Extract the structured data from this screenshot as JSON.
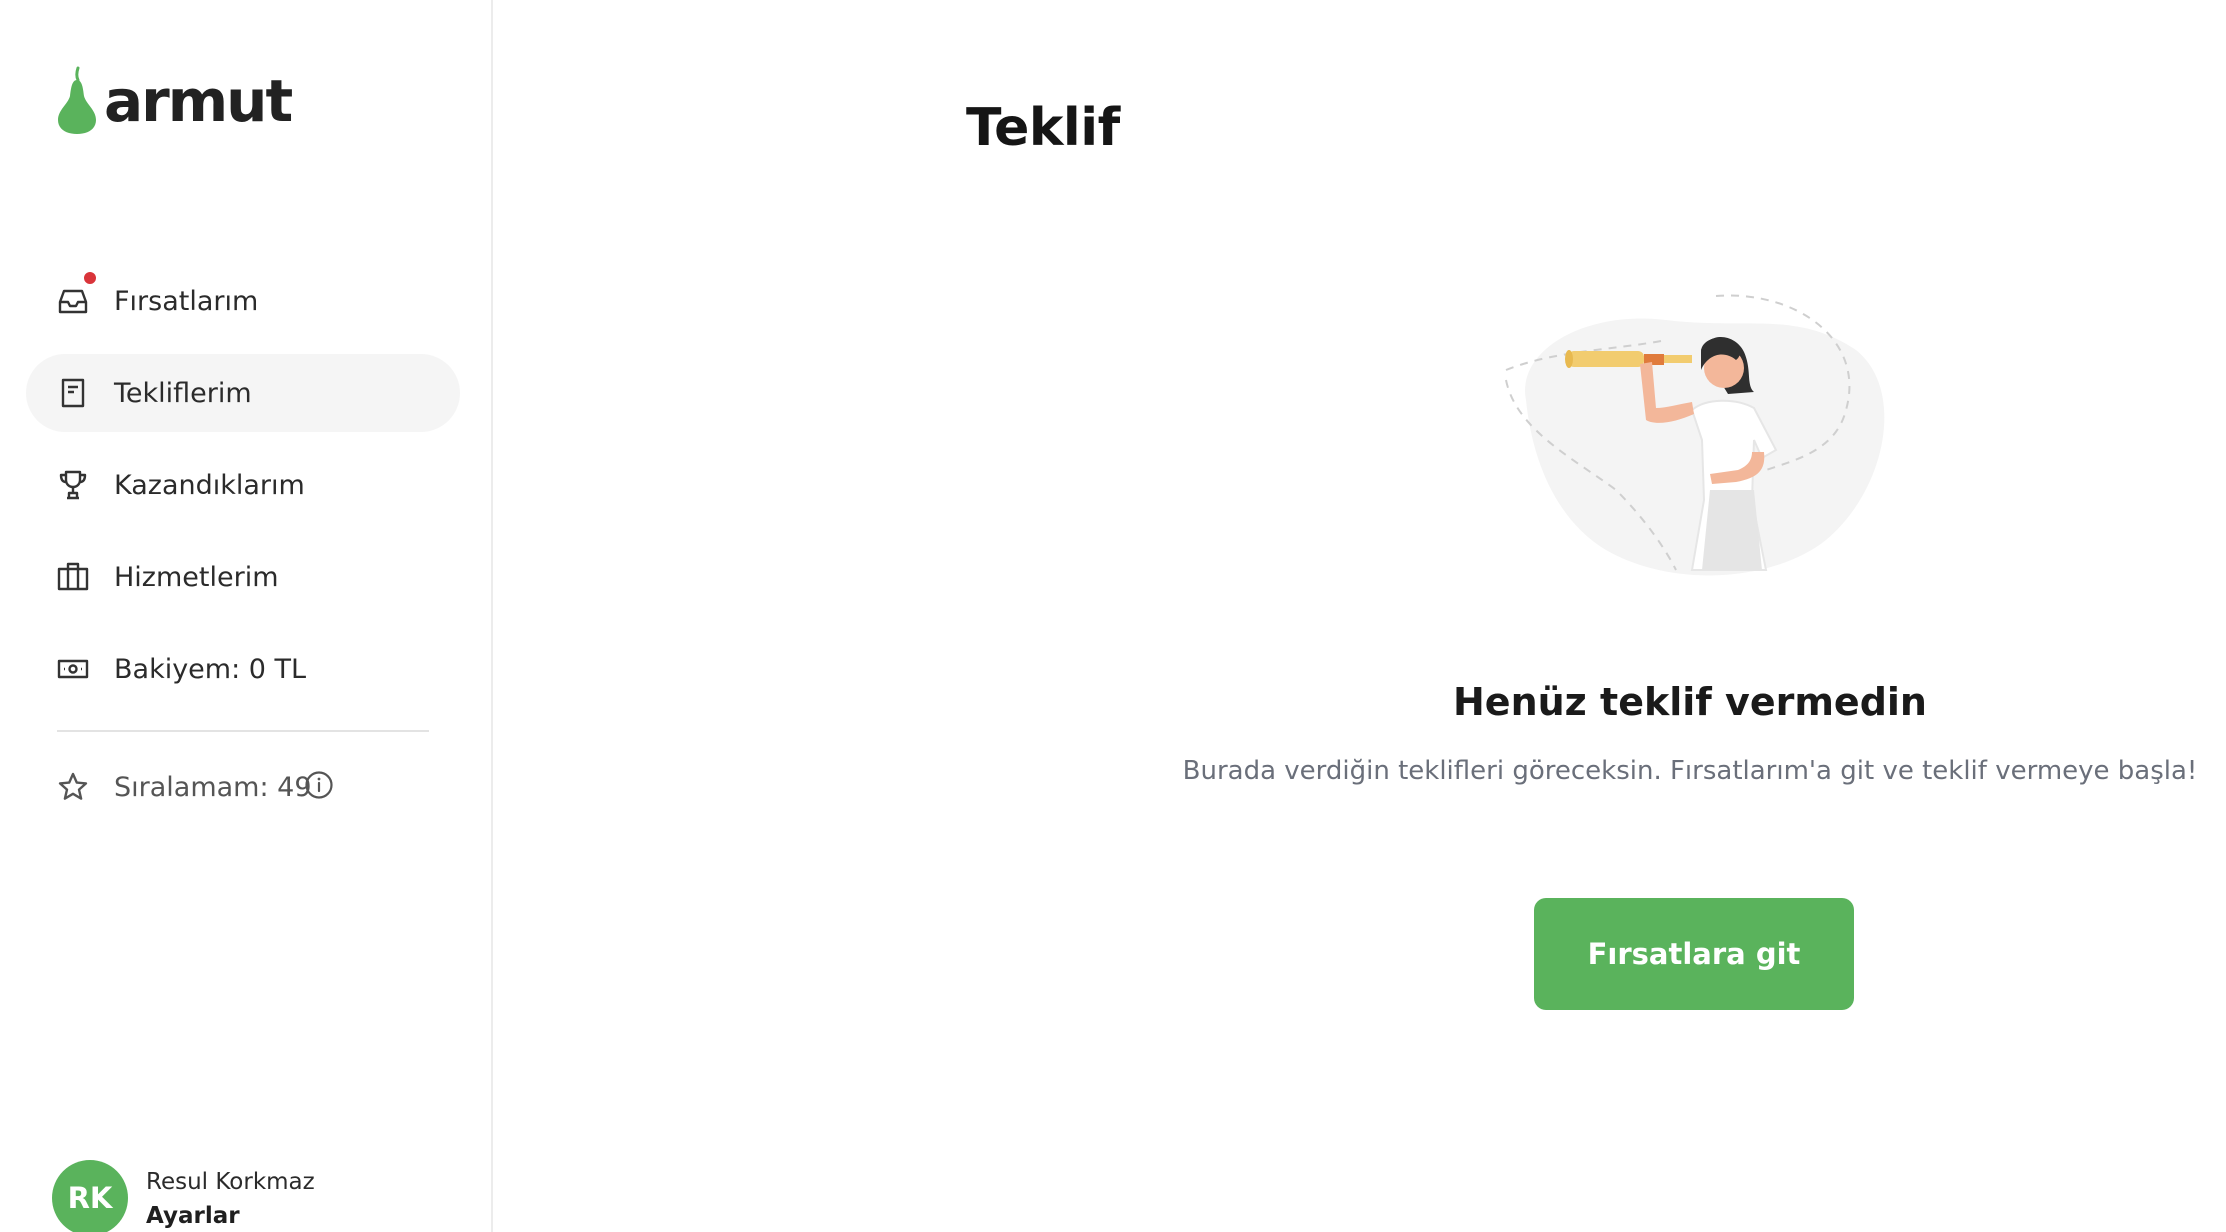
{
  "brand": {
    "name": "armut",
    "color": "#5ab35c"
  },
  "sidebar": {
    "items": [
      {
        "label": "Fırsatlarım",
        "icon": "inbox-icon",
        "has_notification": true,
        "active": false
      },
      {
        "label": "Tekliflerim",
        "icon": "document-icon",
        "active": true
      },
      {
        "label": "Kazandıklarım",
        "icon": "trophy-icon",
        "active": false
      },
      {
        "label": "Hizmetlerim",
        "icon": "briefcase-icon",
        "active": false
      },
      {
        "label": "Bakiyem: 0 TL",
        "icon": "money-icon",
        "active": false
      }
    ],
    "rank": {
      "label": "Sıralamam: 49",
      "icon": "star-icon",
      "info_icon": "info-icon"
    }
  },
  "user": {
    "initials": "RK",
    "name": "Resul Korkmaz",
    "settings_label": "Ayarlar",
    "avatar_color": "#5ab35c"
  },
  "main": {
    "title": "Teklif",
    "empty_state": {
      "title": "Henüz teklif vermedin",
      "description": "Burada verdiğin teklifleri göreceksin. Fırsatlarım'a git ve teklif vermeye başla!",
      "button_label": "Fırsatlara git",
      "illustration": "woman-with-telescope-illustration"
    }
  },
  "colors": {
    "notification": "#d9343a",
    "active_bg": "#f5f5f5",
    "muted_text": "#6a6f7a"
  }
}
